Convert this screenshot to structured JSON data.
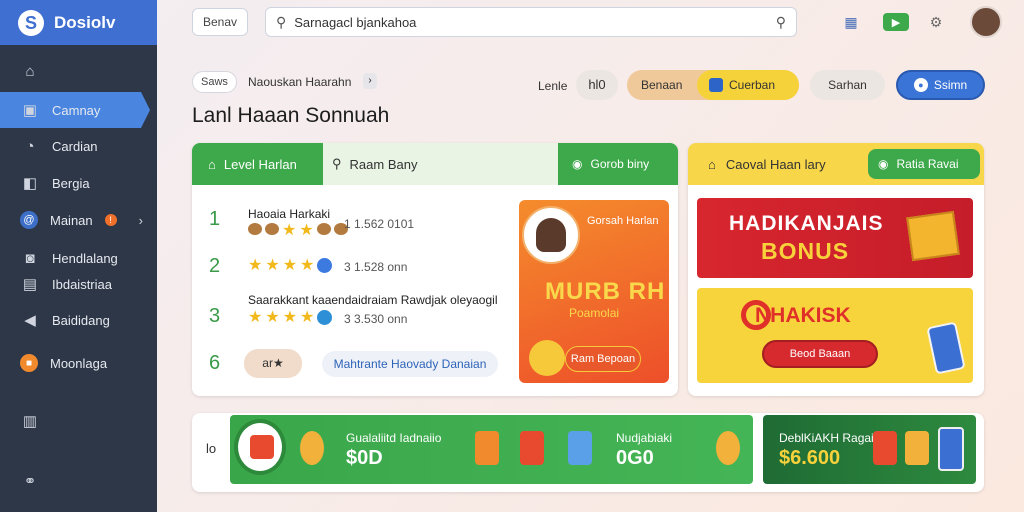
{
  "app": {
    "name": "Dosiolv"
  },
  "sidebar": {
    "items": [
      {
        "label": "",
        "icon": "home-icon"
      },
      {
        "label": "Camnay",
        "icon": "gift-icon",
        "active": true
      },
      {
        "label": "Cardian",
        "icon": "chat-icon"
      },
      {
        "label": "Bergia",
        "icon": "chart-icon"
      },
      {
        "label": "Mainan",
        "icon": "swirl-icon",
        "badge": "!"
      },
      {
        "label": "Hendlalang",
        "icon": "gamepad-icon"
      },
      {
        "label": "Ibdaistriaa",
        "icon": "book-icon"
      },
      {
        "label": "Baididang",
        "icon": "megaphone-icon"
      },
      {
        "label": "Moonlaga",
        "icon": "basket-icon"
      },
      {
        "label": "",
        "icon": "box-icon"
      },
      {
        "label": "",
        "icon": "link-icon"
      }
    ]
  },
  "header": {
    "chip": "Benav",
    "search_value": "Sarnagacl bjankahoa",
    "avatar": "avatar"
  },
  "top": {
    "crumb_chip": "Saws",
    "crumb_text": "Naouskan Haarahn",
    "crumb_arrow": "›",
    "title": "Lanl Haaan Sonnuah",
    "level_label": "Lenle",
    "level_value": "hl0",
    "seg_a": "Benaan",
    "seg_b": "Cuerban",
    "ghost_btn": "Sarhan",
    "blue_btn": "Ssimn"
  },
  "leaderboard": {
    "tab_main": "Level Harlan",
    "tab_search": "Raam Bany",
    "tab_right": "Gorob biny",
    "rows": [
      {
        "rank": "1",
        "name": "Haoaia Harkaki",
        "score": "1 1.562 0101"
      },
      {
        "rank": "2",
        "name": "",
        "score": "3 1.528 onn"
      },
      {
        "rank": "3",
        "name": "Saarakkant kaaendaidraiam Rawdjak oleyaogil",
        "score": "3 3.530 onn"
      },
      {
        "rank": "6",
        "name": "",
        "score": ""
      }
    ],
    "row6_chip": "ar★",
    "row6_link": "Mahtrante Haovady Danaian",
    "promo": {
      "caption": "Gorsah Harlan",
      "big": "MURB RH",
      "sub": "Poamolai",
      "button": "Ram Bepoan"
    }
  },
  "bonus": {
    "tab_main": "Caoval Haan lary",
    "tab_btn": "Ratia Ravai",
    "red_line1": "HADIKANJAIS",
    "red_line2": "BONUS",
    "yellow_title": "NHAKISK",
    "yellow_btn": "Beod Baaan"
  },
  "strip": {
    "left_label": "lo",
    "label1": "Gualaliitd Iadnaiio",
    "value1": "$0D",
    "label2": "Nudjabiaki",
    "value2": "0G0",
    "label3": "DeblKiAKH Ragai",
    "value3": "$6.600"
  }
}
